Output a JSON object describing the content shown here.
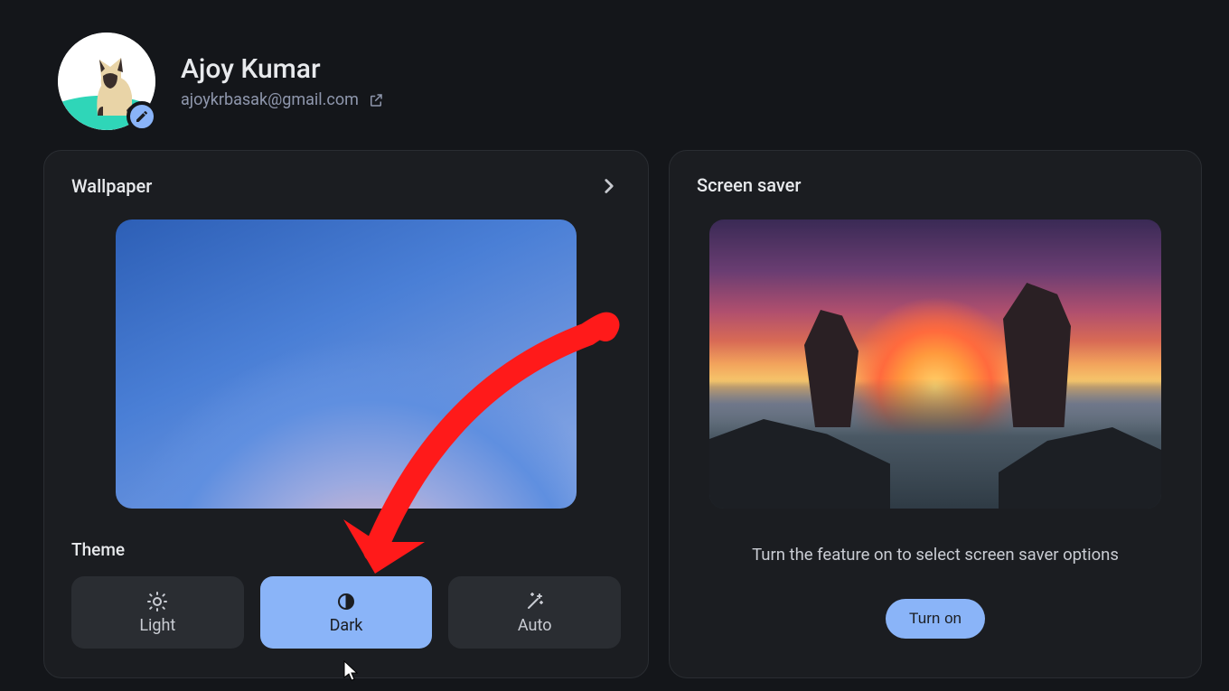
{
  "profile": {
    "name": "Ajoy Kumar",
    "email": "ajoykrbasak@gmail.com"
  },
  "wallpaper": {
    "title": "Wallpaper",
    "theme_label": "Theme",
    "themes": {
      "light": "Light",
      "dark": "Dark",
      "auto": "Auto"
    },
    "selected_theme": "dark"
  },
  "screensaver": {
    "title": "Screen saver",
    "message": "Turn the feature on to select screen saver options",
    "button": "Turn on"
  }
}
